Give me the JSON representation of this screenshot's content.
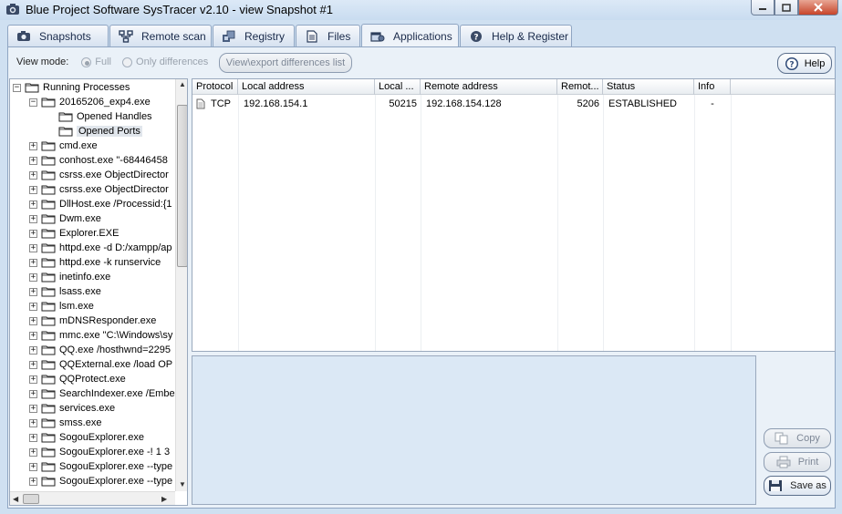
{
  "window": {
    "title": "Blue Project Software SysTracer v2.10 - view Snapshot #1"
  },
  "tabs": [
    {
      "label": "Snapshots",
      "icon": "camera-icon"
    },
    {
      "label": "Remote scan",
      "icon": "network-icon"
    },
    {
      "label": "Registry",
      "icon": "registry-icon"
    },
    {
      "label": "Files",
      "icon": "files-icon"
    },
    {
      "label": "Applications",
      "icon": "applications-icon",
      "active": true
    },
    {
      "label": "Help & Register",
      "icon": "help-icon"
    }
  ],
  "toolbar": {
    "view_mode_label": "View mode:",
    "full_label": "Full",
    "only_diff_label": "Only differences",
    "export_label": "View\\export differences list",
    "help_label": "Help"
  },
  "tree": {
    "root": "Running Processes",
    "items": [
      {
        "label": "20165206_exp4.exe",
        "level": 1,
        "expanded": true
      },
      {
        "label": "Opened Handles",
        "level": 2
      },
      {
        "label": "Opened Ports",
        "level": 2,
        "selected": true
      },
      {
        "label": "cmd.exe",
        "level": 1
      },
      {
        "label": "conhost.exe \"-68446458",
        "level": 1
      },
      {
        "label": "csrss.exe ObjectDirector",
        "level": 1
      },
      {
        "label": "csrss.exe ObjectDirector",
        "level": 1
      },
      {
        "label": "DllHost.exe /Processid:{1",
        "level": 1
      },
      {
        "label": "Dwm.exe",
        "level": 1
      },
      {
        "label": "Explorer.EXE",
        "level": 1
      },
      {
        "label": "httpd.exe -d D:/xampp/ap",
        "level": 1
      },
      {
        "label": "httpd.exe -k runservice",
        "level": 1
      },
      {
        "label": "inetinfo.exe",
        "level": 1
      },
      {
        "label": "lsass.exe",
        "level": 1
      },
      {
        "label": "lsm.exe",
        "level": 1
      },
      {
        "label": "mDNSResponder.exe",
        "level": 1
      },
      {
        "label": "mmc.exe \"C:\\Windows\\sy",
        "level": 1
      },
      {
        "label": "QQ.exe /hosthwnd=2295",
        "level": 1
      },
      {
        "label": "QQExternal.exe /load OP",
        "level": 1
      },
      {
        "label": "QQProtect.exe",
        "level": 1
      },
      {
        "label": "SearchIndexer.exe /Embe",
        "level": 1
      },
      {
        "label": "services.exe",
        "level": 1
      },
      {
        "label": "smss.exe",
        "level": 1
      },
      {
        "label": "SogouExplorer.exe",
        "level": 1
      },
      {
        "label": "SogouExplorer.exe -! 1 3",
        "level": 1
      },
      {
        "label": "SogouExplorer.exe --type",
        "level": 1
      },
      {
        "label": "SogouExplorer.exe --type",
        "level": 1
      }
    ]
  },
  "table": {
    "columns": [
      "Protocol",
      "Local address",
      "Local ...",
      "Remote address",
      "Remot...",
      "Status",
      "Info"
    ],
    "rows": [
      {
        "protocol": "TCP",
        "local_address": "192.168.154.1",
        "local_port": "50215",
        "remote_address": "192.168.154.128",
        "remote_port": "5206",
        "status": "ESTABLISHED",
        "info": "-"
      }
    ]
  },
  "side_buttons": {
    "copy": "Copy",
    "print": "Print",
    "save": "Save as"
  }
}
